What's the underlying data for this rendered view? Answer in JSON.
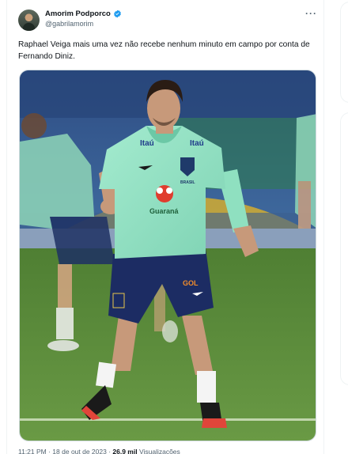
{
  "author": {
    "display_name": "Amorim Podporco",
    "handle": "@gabrilamorim"
  },
  "menu_glyph": "···",
  "tweet": {
    "text": "Raphael Veiga mais uma vez não recebe nenhum minuto em campo por conta de Fernando Diniz."
  },
  "photo": {
    "shirt_sponsor_left": "Itaú",
    "shirt_sponsor_right": "Itaú",
    "shirt_brand": "Guaraná",
    "shorts_sponsor": "GOL",
    "crest_text": "BRASIL"
  },
  "footer": {
    "time_text": "11:21 PM · 18 de out de 2023 · ",
    "views_count": "26,9 mil",
    "views_label": " Visualizações"
  },
  "colors": {
    "verified": "#1d9bf0",
    "shirt": "#8fe0c0",
    "shorts": "#1c2c63",
    "pitch": "#5f8f3a"
  }
}
